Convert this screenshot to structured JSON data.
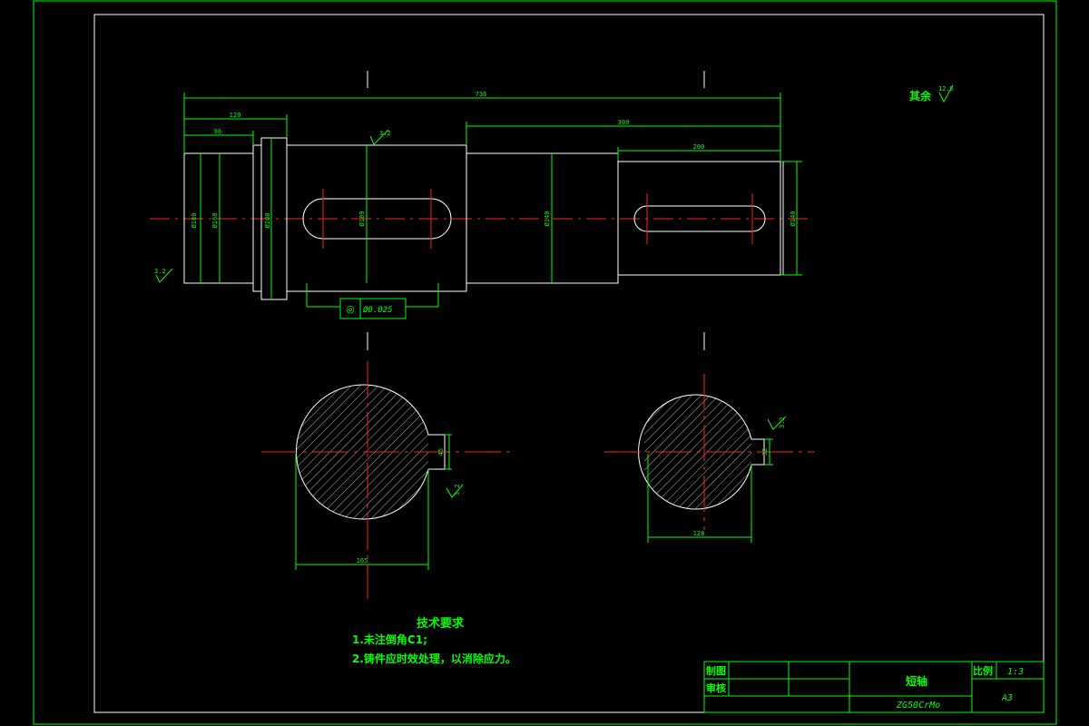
{
  "dimensions": {
    "overall_length": "736",
    "left_section": "120",
    "left_end": "96",
    "right_section": "300",
    "right_end": "200",
    "dia_180": "Ø180",
    "dia_160": "Ø160",
    "dia_200": "Ø200",
    "dia_189": "Ø189",
    "dia_140_mid": "Ø140",
    "dia_140_right": "Ø140",
    "section_a_width": "165",
    "section_a_key": "45",
    "section_b_width": "128",
    "section_b_key": "32"
  },
  "roughness": {
    "top": "3.2",
    "left": "3.2",
    "section_a": "3.2",
    "section_b": "3.2",
    "rest_label": "其余",
    "rest_value": "12.5"
  },
  "tolerance": {
    "symbol": "◎",
    "value": "Ø0.025"
  },
  "notes": {
    "title": "技术要求",
    "line1": "1.未注倒角C1;",
    "line2": "2.铸件应时效处理，以消除应力。"
  },
  "title_block": {
    "drawn_label": "制图",
    "checked_label": "审核",
    "part_name": "短轴",
    "material": "ZG50CrMo",
    "scale_label": "比例",
    "scale_value": "1:3",
    "sheet_size": "A3"
  }
}
